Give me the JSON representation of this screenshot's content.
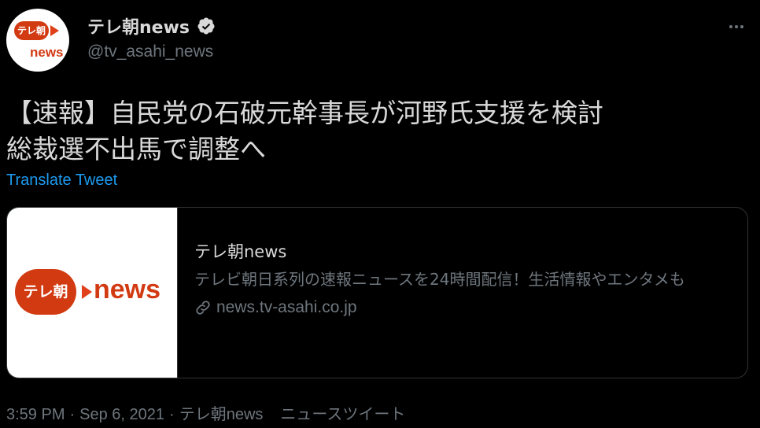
{
  "header": {
    "avatar_pill": "テレ朝",
    "avatar_word": "news",
    "display_name": "テレ朝news",
    "handle": "@tv_asahi_news",
    "verified_icon": "verified-badge-icon",
    "more_icon": "more-dots-icon"
  },
  "tweet": {
    "line1": "【速報】自民党の石破元幹事長が河野氏支援を検討",
    "line2": "総裁選不出馬で調整へ",
    "translate_label": "Translate Tweet"
  },
  "card": {
    "image_pill": "テレ朝",
    "image_word": "news",
    "title": "テレ朝news",
    "description": "テレビ朝日系列の速報ニュースを24時間配信！生活情報やエンタメも",
    "link_icon": "link-icon",
    "domain": "news.tv-asahi.co.jp"
  },
  "footer": {
    "time": "3:59 PM",
    "date": "Sep 6, 2021",
    "author": "テレ朝news",
    "source": "ニュースツイート"
  },
  "colors": {
    "background": "#000000",
    "text": "#d9d9d9",
    "muted": "#6e767d",
    "link": "#1d9bf0",
    "brand": "#d23a12"
  }
}
